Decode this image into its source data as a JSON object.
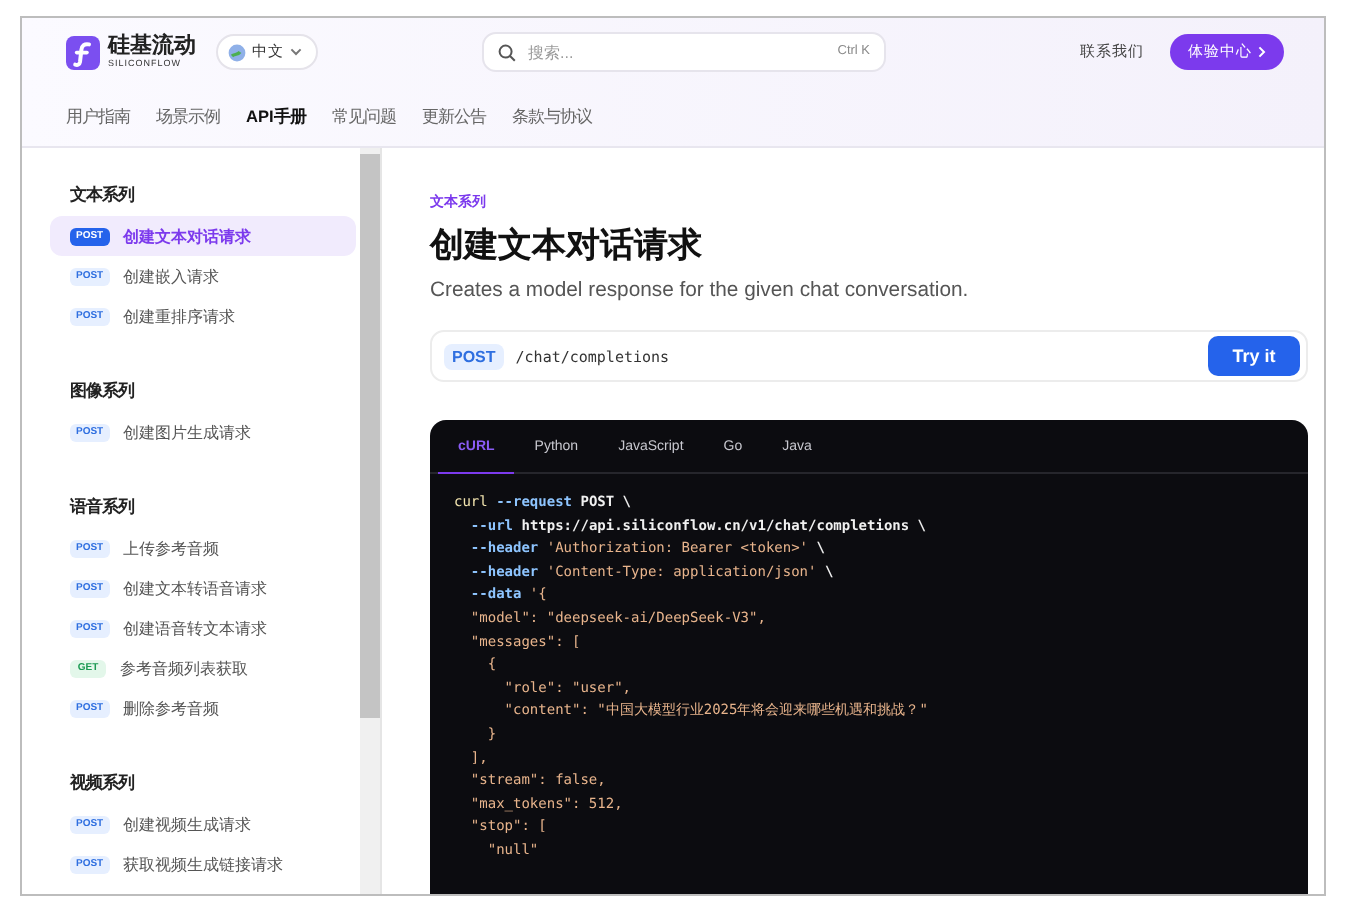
{
  "header": {
    "logo_name": "硅基流动",
    "logo_subtitle": "SILICONFLOW",
    "language": "中文",
    "search": {
      "placeholder": "搜索...",
      "shortcut": "Ctrl K"
    },
    "contact": "联系我们",
    "cta": "体验中心"
  },
  "nav_tabs": [
    {
      "label": "用户指南",
      "selected": false
    },
    {
      "label": "场景示例",
      "selected": false
    },
    {
      "label": "API手册",
      "selected": true
    },
    {
      "label": "常见问题",
      "selected": false
    },
    {
      "label": "更新公告",
      "selected": false
    },
    {
      "label": "条款与协议",
      "selected": false
    }
  ],
  "sidebar": {
    "groups": [
      {
        "title": "文本系列",
        "items": [
          {
            "method": "POST",
            "kind": "post",
            "label": "创建文本对话请求",
            "selected": true
          },
          {
            "method": "POST",
            "kind": "post",
            "label": "创建嵌入请求",
            "selected": false
          },
          {
            "method": "POST",
            "kind": "post",
            "label": "创建重排序请求",
            "selected": false
          }
        ]
      },
      {
        "title": "图像系列",
        "items": [
          {
            "method": "POST",
            "kind": "post",
            "label": "创建图片生成请求",
            "selected": false
          }
        ]
      },
      {
        "title": "语音系列",
        "items": [
          {
            "method": "POST",
            "kind": "post",
            "label": "上传参考音频",
            "selected": false
          },
          {
            "method": "POST",
            "kind": "post",
            "label": "创建文本转语音请求",
            "selected": false
          },
          {
            "method": "POST",
            "kind": "post",
            "label": "创建语音转文本请求",
            "selected": false
          },
          {
            "method": "GET",
            "kind": "get",
            "label": "参考音频列表获取",
            "selected": false
          },
          {
            "method": "POST",
            "kind": "post",
            "label": "删除参考音频",
            "selected": false
          }
        ]
      },
      {
        "title": "视频系列",
        "items": [
          {
            "method": "POST",
            "kind": "post",
            "label": "创建视频生成请求",
            "selected": false
          },
          {
            "method": "POST",
            "kind": "post",
            "label": "获取视频生成链接请求",
            "selected": false
          }
        ]
      }
    ]
  },
  "page": {
    "breadcrumb": "文本系列",
    "title": "创建文本对话请求",
    "description": "Creates a model response for the given chat conversation.",
    "endpoint": {
      "method": "POST",
      "path": "/chat/completions"
    },
    "try_button": "Try it"
  },
  "code": {
    "tabs": [
      {
        "label": "cURL",
        "selected": true
      },
      {
        "label": "Python",
        "selected": false
      },
      {
        "label": "JavaScript",
        "selected": false
      },
      {
        "label": "Go",
        "selected": false
      },
      {
        "label": "Java",
        "selected": false
      }
    ],
    "lines": [
      [
        {
          "kind": "cmd",
          "text": "curl"
        },
        {
          "kind": "flag",
          "text": " --request"
        },
        {
          "kind": "plain",
          "text": " POST \\"
        }
      ],
      [
        {
          "kind": "flag",
          "text": "  --url"
        },
        {
          "kind": "plain",
          "text": " https://api.siliconflow.cn/v1/chat/completions \\"
        }
      ],
      [
        {
          "kind": "flag",
          "text": "  --header"
        },
        {
          "kind": "str",
          "text": " 'Authorization: Bearer <token>'"
        },
        {
          "kind": "plain",
          "text": " \\"
        }
      ],
      [
        {
          "kind": "flag",
          "text": "  --header"
        },
        {
          "kind": "str",
          "text": " 'Content-Type: application/json'"
        },
        {
          "kind": "plain",
          "text": " \\"
        }
      ],
      [
        {
          "kind": "flag",
          "text": "  --data"
        },
        {
          "kind": "str",
          "text": " '{"
        }
      ],
      [
        {
          "kind": "str",
          "text": "  \"model\": \"deepseek-ai/DeepSeek-V3\","
        }
      ],
      [
        {
          "kind": "str",
          "text": "  \"messages\": ["
        }
      ],
      [
        {
          "kind": "str",
          "text": "    {"
        }
      ],
      [
        {
          "kind": "str",
          "text": "      \"role\": \"user\","
        }
      ],
      [
        {
          "kind": "str",
          "text": "      \"content\": \"中国大模型行业2025年将会迎来哪些机遇和挑战？\""
        }
      ],
      [
        {
          "kind": "str",
          "text": "    }"
        }
      ],
      [
        {
          "kind": "str",
          "text": "  ],"
        }
      ],
      [
        {
          "kind": "str",
          "text": "  \"stream\": false,"
        }
      ],
      [
        {
          "kind": "str",
          "text": "  \"max_tokens\": 512,"
        }
      ],
      [
        {
          "kind": "str",
          "text": "  \"stop\": ["
        }
      ],
      [
        {
          "kind": "str",
          "text": "    \"null\""
        }
      ]
    ]
  }
}
